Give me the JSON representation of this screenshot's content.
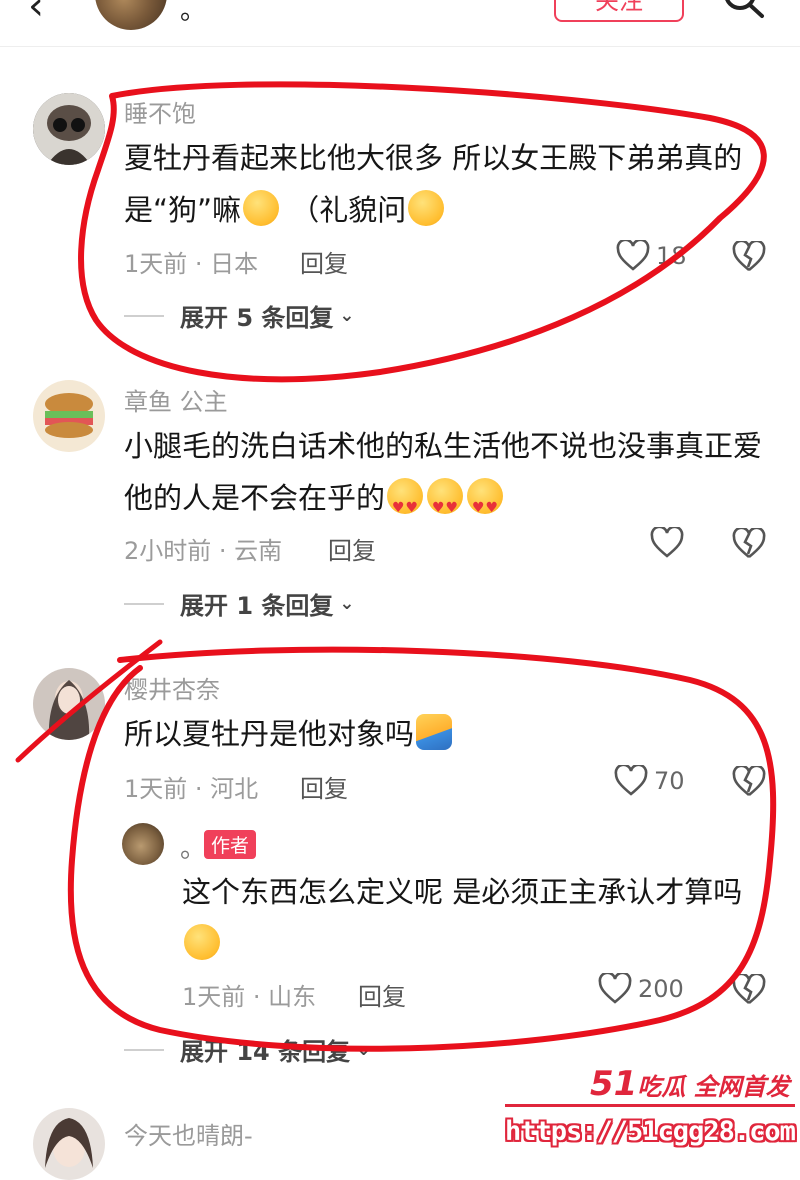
{
  "header": {
    "back_icon": "chevron-left-icon",
    "name": "。",
    "follow_label": "关注",
    "search_icon": "search-icon"
  },
  "comments": [
    {
      "user": "睡不饱",
      "text": "夏牡丹看起来比他大很多 所以女王殿下弟弟真的是“狗”嘛",
      "text_tail": "（礼貌问",
      "meta": "1天前 · 日本",
      "reply": "回复",
      "likes": "18",
      "expand": "展开 5 条回复"
    },
    {
      "user": "章鱼 公主",
      "text": "小腿毛的洗白话术他的私生活他不说也没事真正爱他的人是不会在乎的",
      "meta": "2小时前 · 云南",
      "reply": "回复",
      "likes": "",
      "expand": "展开 1 条回复"
    },
    {
      "user": "樱井杏奈",
      "text": "所以夏牡丹是他对象吗",
      "meta": "1天前 · 河北",
      "reply": "回复",
      "likes": "70",
      "author_reply": {
        "user": "。",
        "badge": "作者",
        "text": "这个东西怎么定义呢 是必须正主承认才算吗",
        "meta": "1天前 · 山东",
        "reply": "回复",
        "likes": "200"
      },
      "expand": "展开 14 条回复"
    },
    {
      "user": "今天也晴朗-"
    }
  ],
  "watermark": {
    "brand_num": "51",
    "brand_text": "吃瓜 全网首发",
    "url": "https://51cgg28.com"
  },
  "colors": {
    "accent": "#f0405a",
    "markup": "#e8101c",
    "watermark": "#e0263c"
  }
}
